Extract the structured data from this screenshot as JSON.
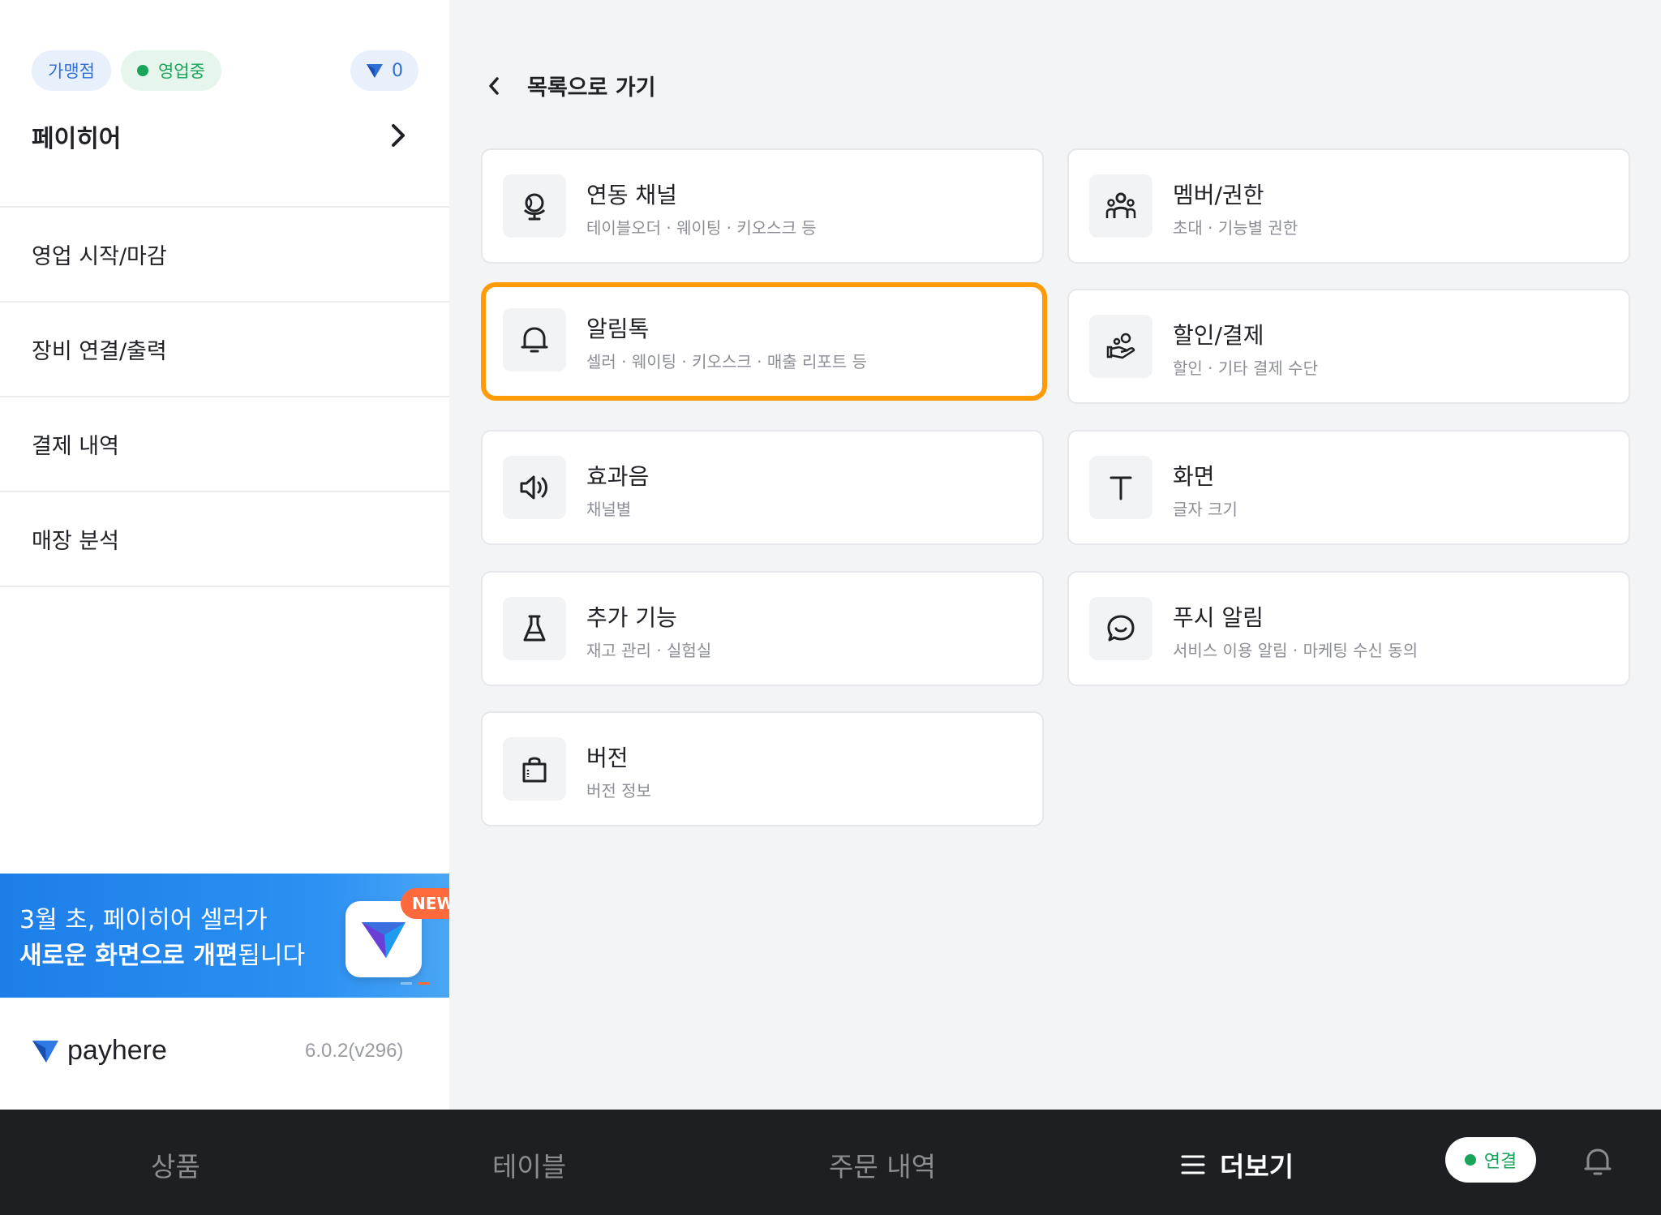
{
  "sidebar": {
    "badge_store_type": "가맹점",
    "badge_status": "영업중",
    "points": "0",
    "store_name": "페이히어",
    "menu": [
      {
        "label": "영업 시작/마감"
      },
      {
        "label": "장비 연결/출력"
      },
      {
        "label": "결제 내역"
      },
      {
        "label": "매장 분석"
      }
    ],
    "banner": {
      "line1": "3월 초, 페이히어 셀러가",
      "line2_bold": "새로운 화면으로 개편",
      "line2_rest": "됩니다",
      "badge": "NEW"
    },
    "logo_text": "payhere",
    "version": "6.0.2(v296)"
  },
  "main": {
    "back_label": "목록으로 가기",
    "cards": [
      {
        "title": "연동 채널",
        "subtitle": "테이블오더 · 웨이팅 · 키오스크 등",
        "icon": "globe-icon"
      },
      {
        "title": "멤버/권한",
        "subtitle": "초대 · 기능별 권한",
        "icon": "members-icon"
      },
      {
        "title": "알림톡",
        "subtitle": "셀러 · 웨이팅 · 키오스크 · 매출 리포트 등",
        "icon": "bell-icon"
      },
      {
        "title": "할인/결제",
        "subtitle": "할인 · 기타 결제 수단",
        "icon": "hand-coin-icon"
      },
      {
        "title": "효과음",
        "subtitle": "채널별",
        "icon": "speaker-icon"
      },
      {
        "title": "화면",
        "subtitle": "글자 크기",
        "icon": "text-size-icon"
      },
      {
        "title": "추가 기능",
        "subtitle": "재고 관리 · 실험실",
        "icon": "flask-icon"
      },
      {
        "title": "푸시 알림",
        "subtitle": "서비스 이용 알림 · 마케팅 수신 동의",
        "icon": "chat-bubble-icon"
      },
      {
        "title": "버전",
        "subtitle": "버전 정보",
        "icon": "shopping-bag-icon"
      }
    ]
  },
  "bottom_nav": {
    "tabs": [
      {
        "label": "상품"
      },
      {
        "label": "테이블"
      },
      {
        "label": "주문 내역"
      },
      {
        "label": "더보기"
      }
    ],
    "connection_label": "연결"
  },
  "colors": {
    "highlight": "#ff9b06",
    "brand_blue": "#2a90f2",
    "status_green": "#19a45a"
  }
}
